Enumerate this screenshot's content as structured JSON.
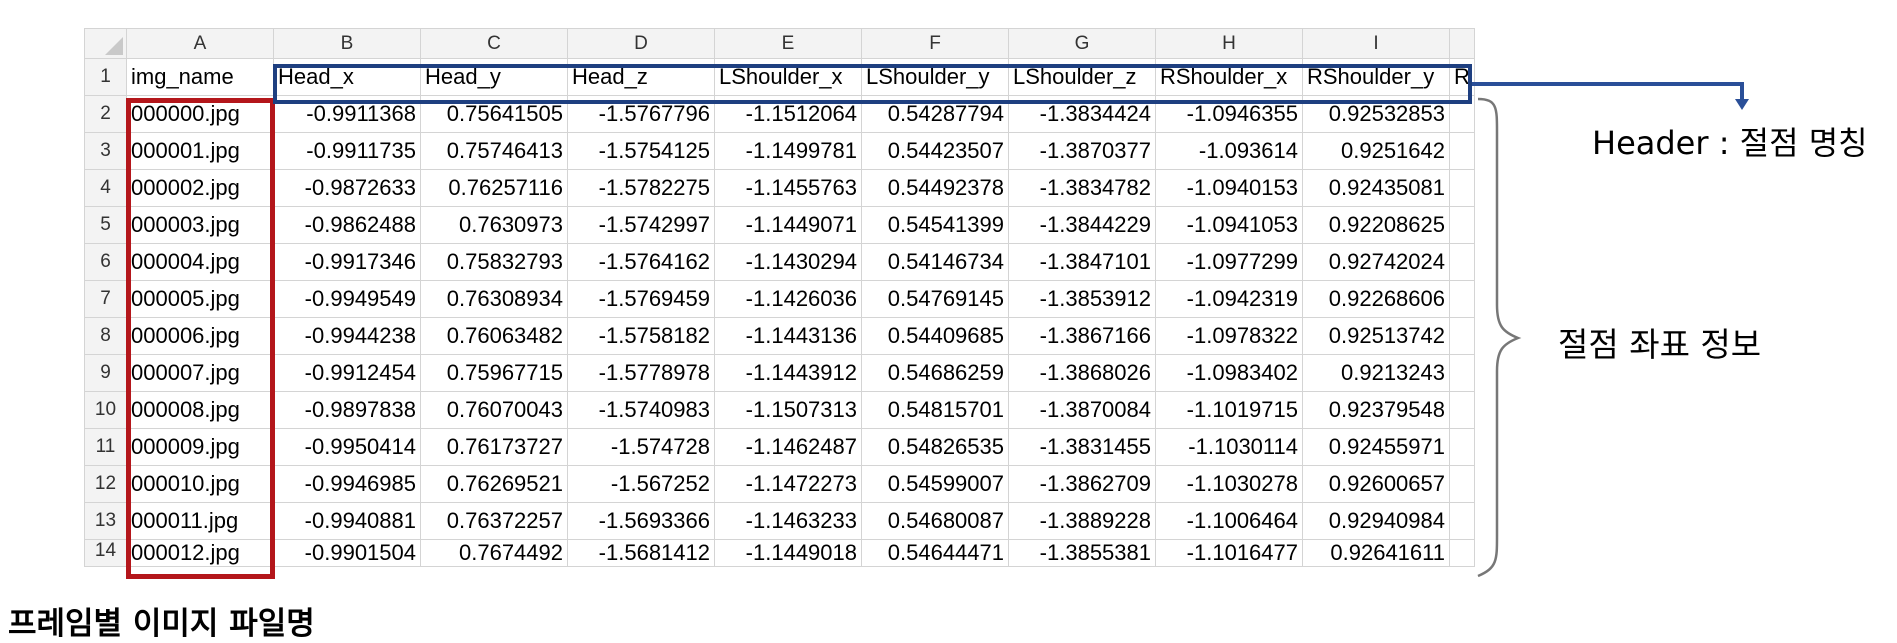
{
  "sheet": {
    "column_letters": [
      "A",
      "B",
      "C",
      "D",
      "E",
      "F",
      "G",
      "H",
      "I",
      ""
    ],
    "header_row_number": "1",
    "headers": [
      "img_name",
      "Head_x",
      "Head_y",
      "Head_z",
      "LShoulder_x",
      "LShoulder_y",
      "LShoulder_z",
      "RShoulder_x",
      "RShoulder_y",
      "R"
    ],
    "rows": [
      {
        "num": "2",
        "cells": [
          "000000.jpg",
          "-0.9911368",
          "0.75641505",
          "-1.5767796",
          "-1.1512064",
          "0.54287794",
          "-1.3834424",
          "-1.0946355",
          "0.92532853",
          ""
        ]
      },
      {
        "num": "3",
        "cells": [
          "000001.jpg",
          "-0.9911735",
          "0.75746413",
          "-1.5754125",
          "-1.1499781",
          "0.54423507",
          "-1.3870377",
          "-1.093614",
          "0.9251642",
          ""
        ]
      },
      {
        "num": "4",
        "cells": [
          "000002.jpg",
          "-0.9872633",
          "0.76257116",
          "-1.5782275",
          "-1.1455763",
          "0.54492378",
          "-1.3834782",
          "-1.0940153",
          "0.92435081",
          ""
        ]
      },
      {
        "num": "5",
        "cells": [
          "000003.jpg",
          "-0.9862488",
          "0.7630973",
          "-1.5742997",
          "-1.1449071",
          "0.54541399",
          "-1.3844229",
          "-1.0941053",
          "0.92208625",
          ""
        ]
      },
      {
        "num": "6",
        "cells": [
          "000004.jpg",
          "-0.9917346",
          "0.75832793",
          "-1.5764162",
          "-1.1430294",
          "0.54146734",
          "-1.3847101",
          "-1.0977299",
          "0.92742024",
          ""
        ]
      },
      {
        "num": "7",
        "cells": [
          "000005.jpg",
          "-0.9949549",
          "0.76308934",
          "-1.5769459",
          "-1.1426036",
          "0.54769145",
          "-1.3853912",
          "-1.0942319",
          "0.92268606",
          ""
        ]
      },
      {
        "num": "8",
        "cells": [
          "000006.jpg",
          "-0.9944238",
          "0.76063482",
          "-1.5758182",
          "-1.1443136",
          "0.54409685",
          "-1.3867166",
          "-1.0978322",
          "0.92513742",
          ""
        ]
      },
      {
        "num": "9",
        "cells": [
          "000007.jpg",
          "-0.9912454",
          "0.75967715",
          "-1.5778978",
          "-1.1443912",
          "0.54686259",
          "-1.3868026",
          "-1.0983402",
          "0.9213243",
          ""
        ]
      },
      {
        "num": "10",
        "cells": [
          "000008.jpg",
          "-0.9897838",
          "0.76070043",
          "-1.5740983",
          "-1.1507313",
          "0.54815701",
          "-1.3870084",
          "-1.1019715",
          "0.92379548",
          ""
        ]
      },
      {
        "num": "11",
        "cells": [
          "000009.jpg",
          "-0.9950414",
          "0.76173727",
          "-1.574728",
          "-1.1462487",
          "0.54826535",
          "-1.3831455",
          "-1.1030114",
          "0.92455971",
          ""
        ]
      },
      {
        "num": "12",
        "cells": [
          "000010.jpg",
          "-0.9946985",
          "0.76269521",
          "-1.567252",
          "-1.1472273",
          "0.54599007",
          "-1.3862709",
          "-1.1030278",
          "0.92600657",
          ""
        ]
      },
      {
        "num": "13",
        "cells": [
          "000011.jpg",
          "-0.9940881",
          "0.76372257",
          "-1.5693366",
          "-1.1463233",
          "0.54680087",
          "-1.3889228",
          "-1.1006464",
          "0.92940984",
          ""
        ]
      },
      {
        "num": "14",
        "cells": [
          "000012.jpg",
          "-0.9901504",
          "0.7674492",
          "-1.5681412",
          "-1.1449018",
          "0.54644471",
          "-1.3855381",
          "-1.1016477",
          "0.92641611",
          ""
        ]
      }
    ]
  },
  "annotations": {
    "header_label": "Header : 절점 명칭",
    "coords_label": "절점 좌표 정보",
    "filenames_label": "프레임별 이미지 파일명",
    "header_box_color": "#1e3f80",
    "filename_box_color": "#b4161b",
    "brace_color": "#777777"
  }
}
